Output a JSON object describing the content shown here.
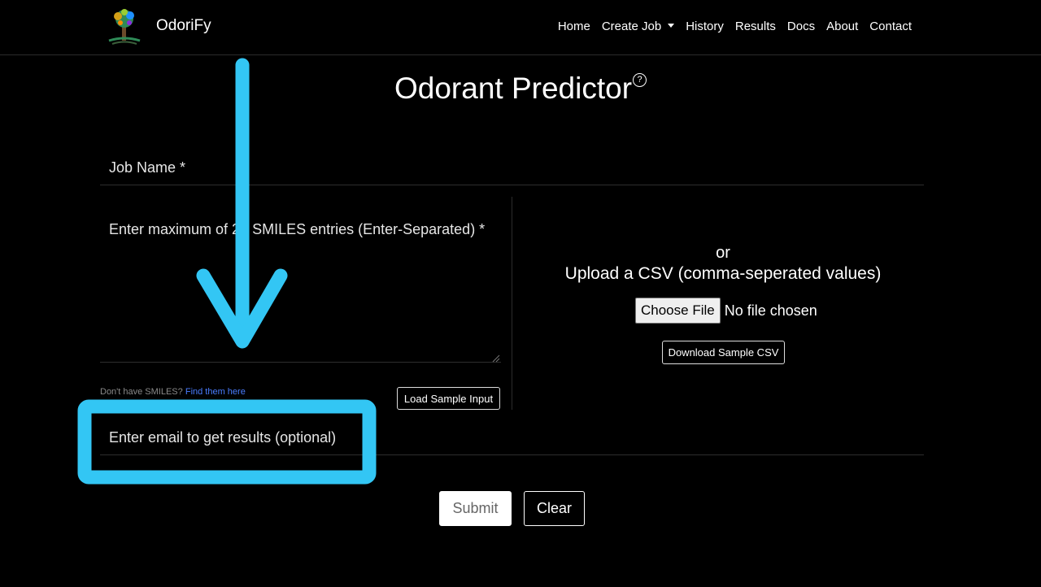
{
  "navbar": {
    "brand": "OdoriFy",
    "links": [
      "Home",
      "Create Job",
      "History",
      "Results",
      "Docs",
      "About",
      "Contact"
    ]
  },
  "page": {
    "title": "Odorant Predictor",
    "help_icon": "?"
  },
  "form": {
    "job_name_placeholder": "Job Name *",
    "smiles_placeholder": "Enter maximum of 25 SMILES entries (Enter-Separated) *",
    "helper_text": "Don't have SMILES?",
    "helper_link": "Find them here",
    "load_sample_label": "Load Sample Input",
    "or_text": "or",
    "upload_label": "Upload a CSV (comma-seperated values)",
    "choose_file_label": "Choose File",
    "no_file_text": "No file chosen",
    "download_sample_label": "Download Sample CSV",
    "email_placeholder": "Enter email to get results (optional)",
    "submit_label": "Submit",
    "clear_label": "Clear"
  },
  "annotation": {
    "color": "#33c6f4"
  }
}
